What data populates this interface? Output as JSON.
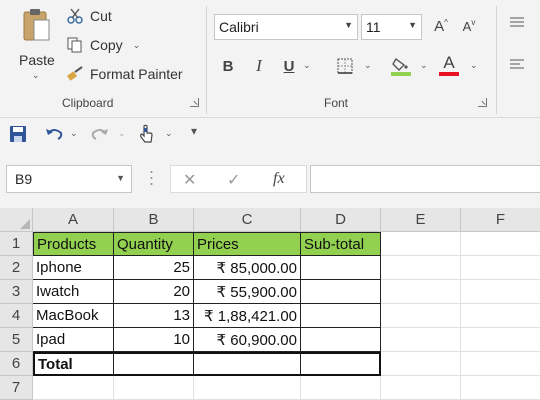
{
  "clipboard": {
    "paste": "Paste",
    "cut": "Cut",
    "copy": "Copy",
    "format_painter": "Format Painter",
    "group_label": "Clipboard"
  },
  "font": {
    "name": "Calibri",
    "size": "11",
    "group_label": "Font",
    "bold": "B",
    "italic": "I",
    "underline": "U",
    "grow": "A",
    "shrink": "A",
    "color_letter": "A",
    "highlight_color": "#92d050",
    "font_color": "#e81123"
  },
  "namebox": "B9",
  "formula_fx": "fx",
  "columns": [
    "A",
    "B",
    "C",
    "D",
    "E",
    "F"
  ],
  "rows": [
    "1",
    "2",
    "3",
    "4",
    "5",
    "6",
    "7"
  ],
  "sheet": {
    "header": [
      "Products",
      "Quantity",
      "Prices",
      "Sub-total"
    ],
    "data": [
      [
        "Iphone",
        "25",
        "₹ 85,000.00",
        ""
      ],
      [
        "Iwatch",
        "20",
        "₹ 55,900.00",
        ""
      ],
      [
        "MacBook",
        "13",
        "₹ 1,88,421.00",
        ""
      ],
      [
        "Ipad",
        "10",
        "₹ 60,900.00",
        ""
      ]
    ],
    "total_label": "Total"
  },
  "colors": {
    "header_fill": "#92d050",
    "ribbon_bg": "#f3f3f3",
    "save_icon": "#2f5597",
    "undo_icon": "#2f5597"
  }
}
